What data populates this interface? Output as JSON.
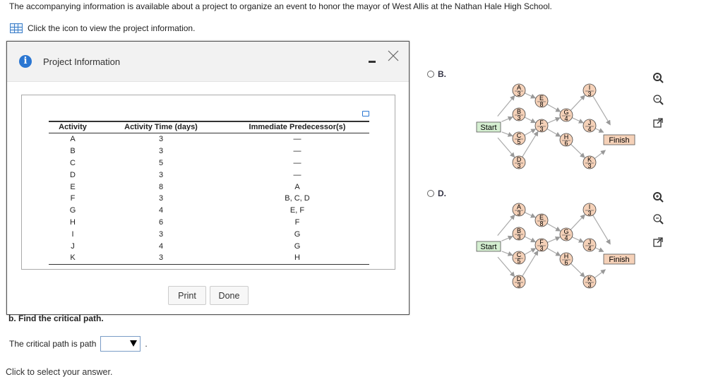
{
  "intro_text": "The accompanying information is available about a project to organize an event to honor the mayor of West Allis at the Nathan Hale High School.",
  "icon_instruction": "Click the icon to view the project information.",
  "question_b": "b. Find the critical path.",
  "critical_path_label": "The critical path is path",
  "period": ".",
  "critical_path_value": "",
  "click_select": "Click to select your answer.",
  "modal": {
    "title": "Project Information",
    "table": {
      "headers": [
        "Activity",
        "Activity Time (days)",
        "Immediate Predecessor(s)"
      ],
      "rows": [
        [
          "A",
          "3",
          "—"
        ],
        [
          "B",
          "3",
          "—"
        ],
        [
          "C",
          "5",
          "—"
        ],
        [
          "D",
          "3",
          "—"
        ],
        [
          "E",
          "8",
          "A"
        ],
        [
          "F",
          "3",
          "B, C, D"
        ],
        [
          "G",
          "4",
          "E, F"
        ],
        [
          "H",
          "6",
          "F"
        ],
        [
          "I",
          "3",
          "G"
        ],
        [
          "J",
          "4",
          "G"
        ],
        [
          "K",
          "3",
          "H"
        ]
      ]
    },
    "print_label": "Print",
    "done_label": "Done"
  },
  "options": [
    {
      "label": "B."
    },
    {
      "label": "D."
    }
  ],
  "network": {
    "start": "Start",
    "finish": "Finish",
    "nodes": [
      {
        "name": "A",
        "time": "3"
      },
      {
        "name": "B",
        "time": "3"
      },
      {
        "name": "C",
        "time": "5"
      },
      {
        "name": "D",
        "time": "3"
      },
      {
        "name": "E",
        "time": "8"
      },
      {
        "name": "F",
        "time": "3"
      },
      {
        "name": "G",
        "time": "4"
      },
      {
        "name": "H",
        "time": "6"
      },
      {
        "name": "I",
        "time": "3"
      },
      {
        "name": "J",
        "time": "4"
      },
      {
        "name": "K",
        "time": "3"
      }
    ]
  },
  "colors": {
    "node_fill": "#f5d1b8",
    "start_fill": "#d4eed0",
    "finish_fill": "#f5d1b8",
    "accent": "#2a76d2"
  }
}
